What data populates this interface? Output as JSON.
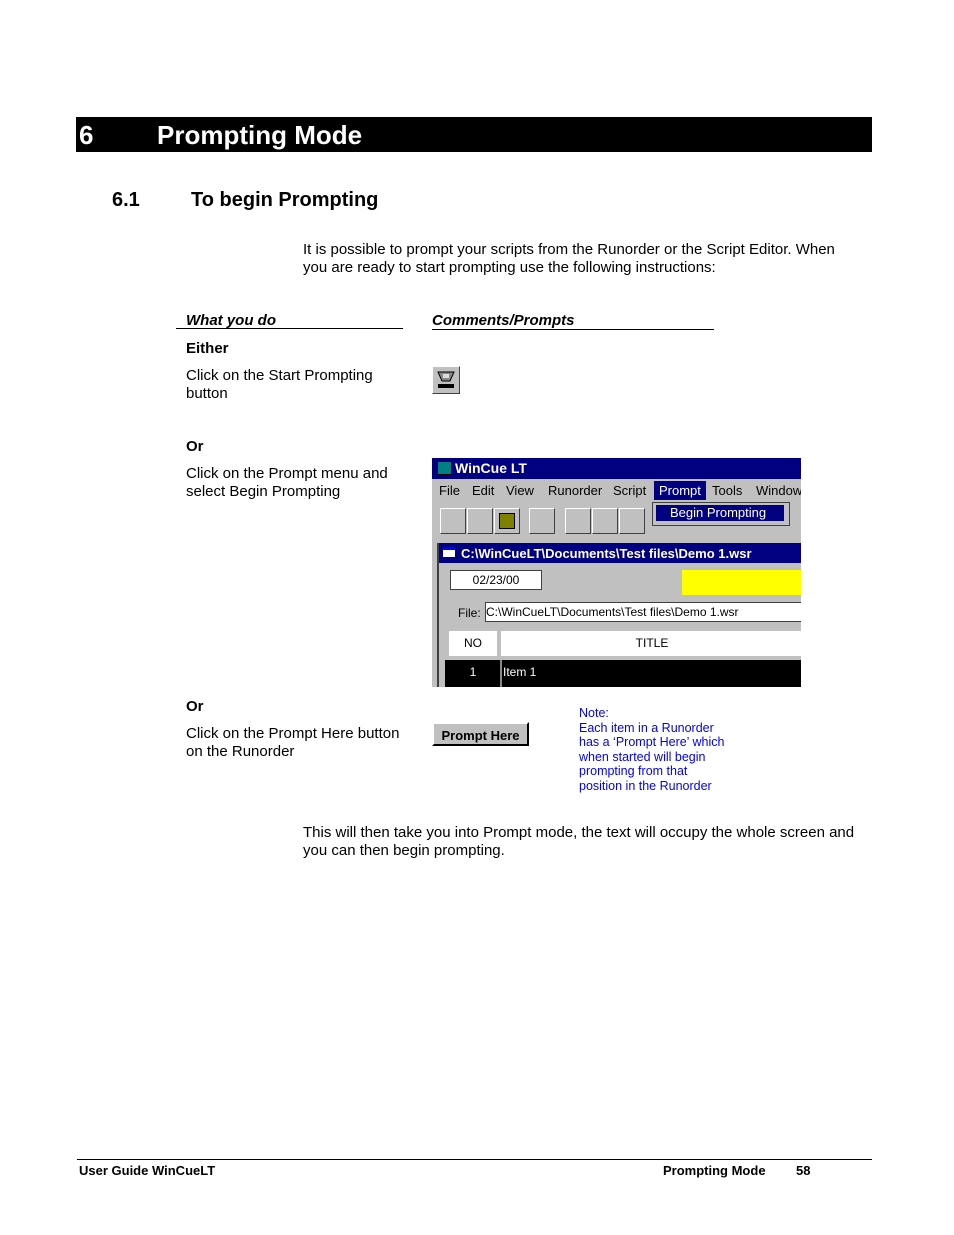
{
  "chapter": {
    "number": "6",
    "title": "Prompting Mode"
  },
  "section": {
    "number": "6.1",
    "title": "To begin Prompting"
  },
  "intro": "It is possible to prompt your scripts from the Runorder or the Script Editor. When you are ready to start prompting use the following instructions:",
  "columns": {
    "what": "What you do",
    "comments": "Comments/Prompts"
  },
  "steps": [
    {
      "lead": "Either",
      "text": "Click on the Start Prompting button"
    },
    {
      "lead": "Or",
      "text": "Click on the Prompt menu and select Begin Prompting"
    },
    {
      "lead": "Or",
      "text": "Click on the Prompt Here button on the Runorder"
    }
  ],
  "window": {
    "title": "WinCue LT",
    "menus": [
      "File",
      "Edit",
      "View",
      "Runorder",
      "Script",
      "Prompt",
      "Tools",
      "Window"
    ],
    "dropdown_item": "Begin Prompting",
    "doc_title": "C:\\WinCueLT\\Documents\\Test files\\Demo 1.wsr",
    "date": "02/23/00",
    "file_label": "File:",
    "file_path": "C:\\WinCueLT\\Documents\\Test files\\Demo 1.wsr",
    "col_no": "NO",
    "col_title": "TITLE",
    "row_no": "1",
    "row_title": "Item 1",
    "highlight_color": "#ffff00",
    "title_color": "#000080"
  },
  "prompt_here_button": "Prompt Here",
  "note": [
    "Note:",
    "Each item in a Runorder",
    "has a ‘Prompt Here’ which",
    "when started will begin",
    "prompting from that",
    "position in the Runorder"
  ],
  "outro": "This will then take you into Prompt mode, the text will occupy the whole screen and you can then begin prompting.",
  "footer": {
    "left": "User Guide WinCueLT",
    "section": "Prompting Mode",
    "page": "58"
  }
}
